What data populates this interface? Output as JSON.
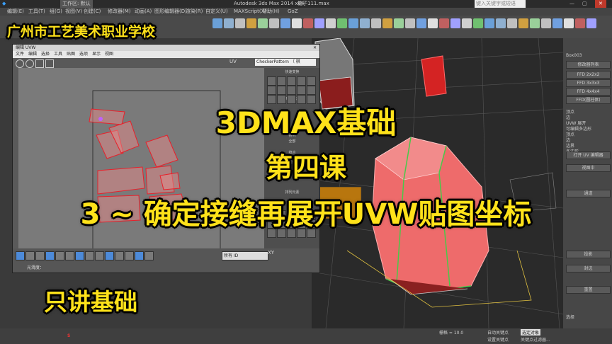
{
  "app": {
    "title": "Autodesk 3ds Max  2014 x64",
    "file": "箱子111.max",
    "workspace": "工作区: 默认",
    "search_placeholder": "键入关键字或短语"
  },
  "menus": [
    "编辑(E)",
    "工具(T)",
    "组(G)",
    "视图(V)",
    "创建(C)",
    "修改器(M)",
    "动画(A)",
    "图形编辑器(D)",
    "渲染(R)",
    "自定义(U)",
    "MAXScript(X)",
    "帮助(H)",
    "GoZ"
  ],
  "uv_editor": {
    "title": "编辑 UVW",
    "menus": [
      "文件",
      "编辑",
      "选择",
      "工具",
      "贴图",
      "选项",
      "显示",
      "视图"
    ],
    "uv_label": "UV",
    "texture_select": "CheckerPattern  （ 棋",
    "side_labels": [
      "快速变换",
      "重新塑造元素",
      "排列",
      "全部",
      "缝合",
      "剥",
      "排列元素"
    ],
    "bottom_id_select": "所有 ID",
    "xy_label": "XY",
    "bottom_label": "光滑度："
  },
  "command_panel": {
    "object_name": "Box003",
    "modifier_list": "修改器列表",
    "buttons": [
      "FFD 2x2x2",
      "FFD 3x3x3",
      "FFD 4x4x4",
      "FFD(圆柱体)"
    ],
    "stack": [
      "顶点",
      "边",
      "UVW 展开",
      "可编辑多边形",
      "顶点",
      "边",
      "边界",
      "多边形",
      "元素"
    ],
    "sections": [
      "打开 UV 编辑器",
      "视图中",
      "通道",
      "投影",
      "封边",
      "重置"
    ],
    "label_sel": "选择"
  },
  "status": {
    "grid": "栅格 = 10.0",
    "autokey": "自动关键点",
    "selected_obj": "选定对象",
    "set_key": "设置关键点",
    "key_filter": "关键点过滤器..."
  },
  "overlay": {
    "school": "广州市工艺美术职业学校",
    "line1": "3DMAX基础",
    "line2": "第四课",
    "line3": "3 ~ 确定接缝再展开UVW贴图坐标",
    "line4": "只讲基础"
  },
  "colors": {
    "overlay_text": "#ffe21a",
    "uv_shell": "#e8202a",
    "mesh_fill": "#ee6b6b"
  }
}
